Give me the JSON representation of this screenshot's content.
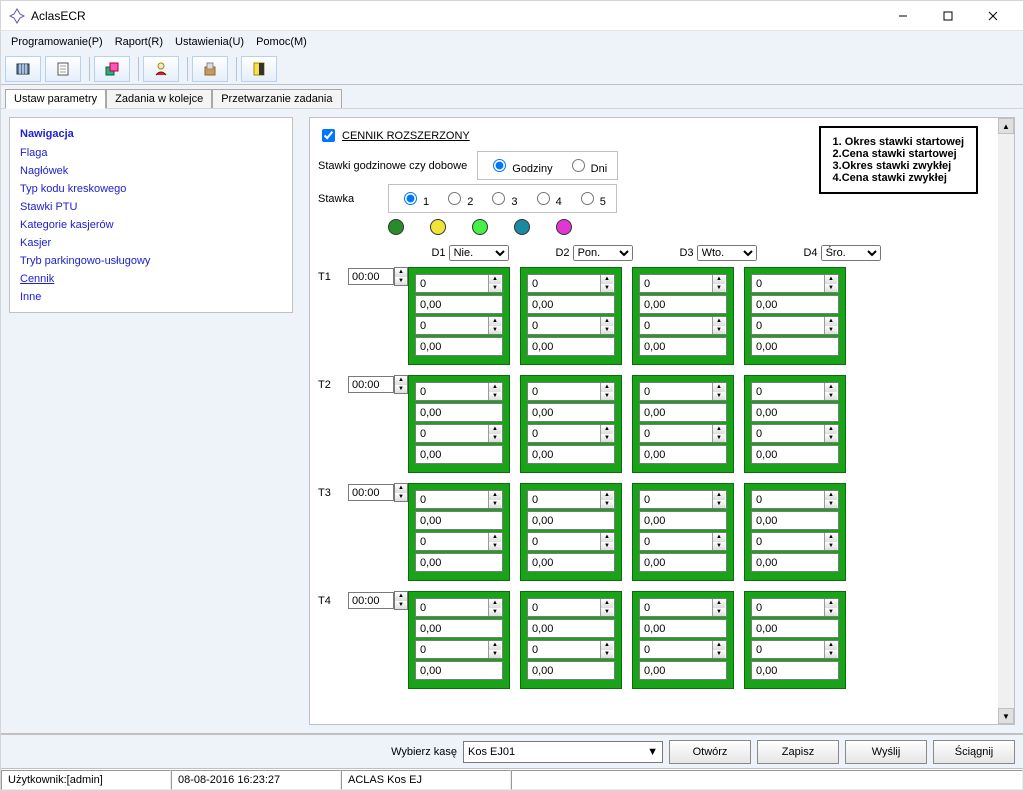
{
  "window": {
    "title": "AclasECR"
  },
  "menubar": [
    "Programowanie(P)",
    "Raport(R)",
    "Ustawienia(U)",
    "Pomoc(M)"
  ],
  "tabs": {
    "items": [
      "Ustaw parametry",
      "Zadania w kolejce",
      "Przetwarzanie zadania"
    ],
    "active": 0
  },
  "sidebar": {
    "title": "Nawigacja",
    "items": [
      "Flaga",
      "Nagłówek",
      "Typ kodu kreskowego",
      "Stawki PTU",
      "Kategorie kasjerów",
      "Kasjer",
      "Tryb parkingowo-usługowy",
      "Cennik",
      "Inne"
    ],
    "active": "Cennik"
  },
  "main": {
    "checkbox_label": "CENNIK ROZSZERZONY",
    "rate_basis_label": "Stawki godzinowe czy dobowe",
    "rate_basis_options": [
      "Godziny",
      "Dni"
    ],
    "rate_basis_selected": 0,
    "stawka_label": "Stawka",
    "stawka_count": 5,
    "stawka_selected": 1,
    "dot_colors": [
      "#2a8b2a",
      "#f1e438",
      "#47f047",
      "#1a8aa0",
      "#e236d2"
    ],
    "days": [
      {
        "label": "D1",
        "value": "Nie."
      },
      {
        "label": "D2",
        "value": "Pon."
      },
      {
        "label": "D3",
        "value": "Wto."
      },
      {
        "label": "D4",
        "value": "Śro."
      }
    ],
    "time_rows": [
      {
        "label": "T1",
        "time": "00:00"
      },
      {
        "label": "T2",
        "time": "00:00"
      },
      {
        "label": "T3",
        "time": "00:00"
      },
      {
        "label": "T4",
        "time": "00:00"
      }
    ],
    "cell_values": [
      "0",
      "0,00",
      "0",
      "0,00"
    ]
  },
  "legend": [
    "1. Okres stawki startowej",
    "2.Cena stawki startowej",
    "3.Okres stawki zwykłej",
    "4.Cena stawki zwykłej"
  ],
  "bottom": {
    "wybierz_label": "Wybierz kasę",
    "kasa_value": "Kos EJ01",
    "buttons": [
      "Otwórz",
      "Zapisz",
      "Wyślij",
      "Ściągnij"
    ]
  },
  "status": {
    "user": "Użytkownik:[admin]",
    "datetime": "08-08-2016 16:23:27",
    "device": "ACLAS Kos EJ"
  }
}
